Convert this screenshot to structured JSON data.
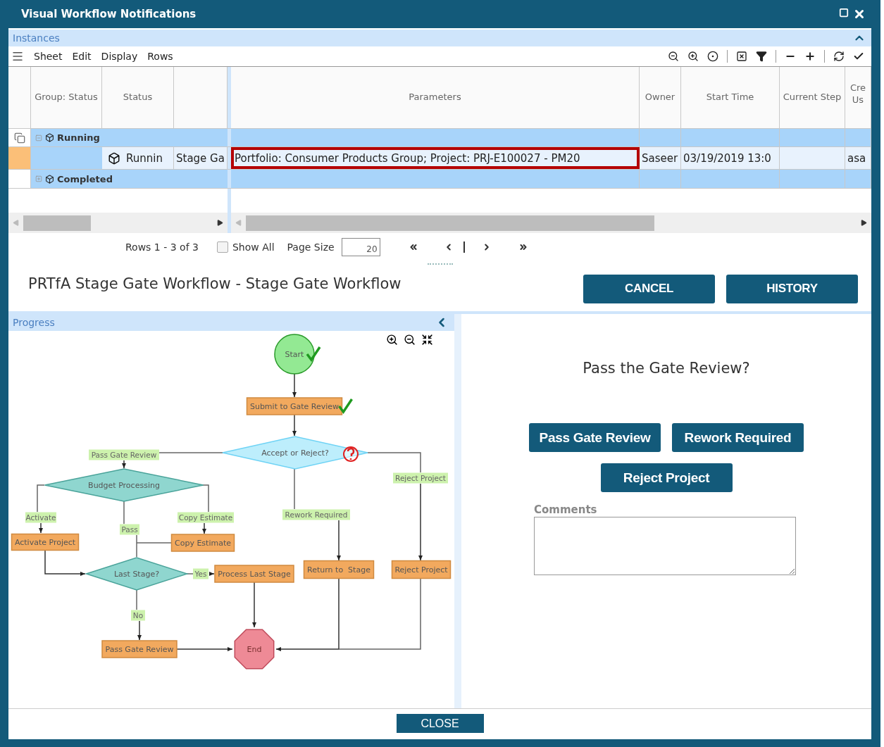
{
  "window": {
    "title": "Visual Workflow Notifications"
  },
  "instances": {
    "title": "Instances",
    "expanded": true,
    "menu": [
      "Sheet",
      "Edit",
      "Display",
      "Rows"
    ],
    "table": {
      "columns": {
        "group_status": "Group: Status",
        "status": "Status",
        "parameters": "Parameters",
        "owner": "Owner",
        "start_time": "Start Time",
        "current_step": "Current Step",
        "column_9": "Cre Us"
      },
      "groups": [
        {
          "label": "Running",
          "expanded": true,
          "rows": [
            {
              "selected": true,
              "focused": true,
              "status": "Runnin",
              "column_4": "Stage Ga",
              "parameters": "Portfolio: Consumer Products Group; Project: PRJ-E100027 - PM20",
              "owner": "Saseer",
              "start_time": "03/19/2019 13:0",
              "column_9": "asa"
            }
          ]
        },
        {
          "label": "Completed",
          "expanded": false
        }
      ]
    },
    "pager": {
      "rows_text": "Rows 1 - 3 of 3",
      "show_all": {
        "label": "Show All",
        "checked": false
      },
      "page_size_label": "Page Size",
      "page_size": "20"
    }
  },
  "workflow": {
    "title": "PRTfA Stage Gate Workflow - Stage Gate Workflow",
    "buttons": [
      "CANCEL",
      "HISTORY"
    ]
  },
  "progress": {
    "title": "Progress",
    "nodes": [
      {
        "kind": "start",
        "label": "Start",
        "completed": true,
        "current": false
      },
      {
        "kind": "task",
        "label": "Submit to Gate Review",
        "completed": true,
        "current": false
      },
      {
        "kind": "label",
        "label": "Pass Gate Review",
        "completed": false,
        "current": false
      },
      {
        "kind": "gate",
        "label": "Accept or Reject?",
        "completed": false,
        "current": true
      },
      {
        "kind": "label",
        "label": "Reject Project",
        "completed": false,
        "current": false
      },
      {
        "kind": "decision",
        "label": "Budget Processing",
        "completed": false,
        "current": false
      },
      {
        "kind": "label",
        "label": "Activate",
        "completed": false,
        "current": false
      },
      {
        "kind": "label",
        "label": "Copy Estimate",
        "completed": false,
        "current": false
      },
      {
        "kind": "label",
        "label": "Rework Required",
        "completed": false,
        "current": false
      },
      {
        "kind": "label",
        "label": "Pass",
        "completed": false,
        "current": false
      },
      {
        "kind": "task",
        "label": "Activate Project",
        "completed": false,
        "current": false
      },
      {
        "kind": "task",
        "label": "Copy Estimate",
        "completed": false,
        "current": false
      },
      {
        "kind": "decision",
        "label": "Last Stage?",
        "completed": false,
        "current": false
      },
      {
        "kind": "label",
        "label": "Yes",
        "completed": false,
        "current": false
      },
      {
        "kind": "task",
        "label": "Process Last Stage",
        "completed": false,
        "current": false
      },
      {
        "kind": "task",
        "label": "Return to  Stage",
        "completed": false,
        "current": false
      },
      {
        "kind": "task",
        "label": "Reject Project",
        "completed": false,
        "current": false
      },
      {
        "kind": "label",
        "label": "No",
        "completed": false,
        "current": false
      },
      {
        "kind": "task",
        "label": "Pass Gate Review",
        "completed": false,
        "current": false
      },
      {
        "kind": "end",
        "label": "End",
        "completed": false,
        "current": false
      }
    ]
  },
  "decision": {
    "question": "Pass the Gate Review?",
    "buttons": [
      "Pass Gate Review",
      "Rework Required",
      "Reject Project"
    ],
    "comments": {
      "label": "Comments"
    }
  },
  "footer": {
    "button": "CLOSE"
  }
}
